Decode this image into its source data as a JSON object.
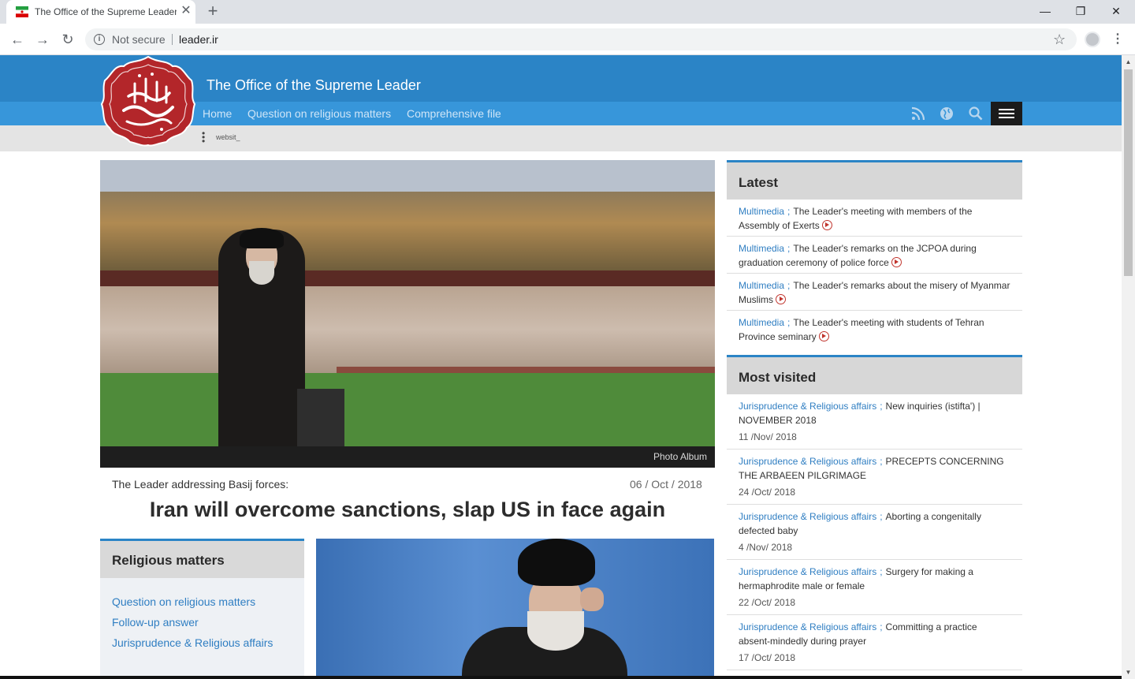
{
  "browser": {
    "tab_title": "The Office of the Supreme Leader",
    "tab_close": "✕",
    "new_tab": "+",
    "window_controls": {
      "minimize": "—",
      "maximize": "❐",
      "close": "✕"
    },
    "security_label": "Not secure",
    "url": "leader.ir"
  },
  "site": {
    "title": "The Office of the Supreme Leader",
    "nav": [
      "Home",
      "Question on religious matters",
      "Comprehensive file"
    ],
    "sub_text": "websit_",
    "colors": {
      "header": "#2b84c6",
      "nav": "#3796da",
      "accent": "#c0342d"
    }
  },
  "featured": {
    "caption": "Photo Album",
    "kicker": "The Leader addressing Basij forces:",
    "date": "06 / Oct / 2018",
    "headline": "Iran will overcome sanctions, slap US in face again"
  },
  "religious": {
    "title": "Religious matters",
    "links": [
      "Question on religious matters",
      "Follow-up answer",
      "Jurisprudence & Religious affairs"
    ]
  },
  "latest": {
    "title": "Latest",
    "items": [
      {
        "category": "Multimedia",
        "text": "The Leader's meeting with members of the Assembly of Exerts"
      },
      {
        "category": "Multimedia",
        "text": "The Leader's remarks on the JCPOA during graduation ceremony of police force"
      },
      {
        "category": "Multimedia",
        "text": "The Leader's remarks about the misery of Myanmar Muslims"
      },
      {
        "category": "Multimedia",
        "text": "The Leader's meeting with students of Tehran Province seminary"
      }
    ]
  },
  "most_visited": {
    "title": "Most visited",
    "items": [
      {
        "category": "Jurisprudence & Religious affairs",
        "text": "New inquiries (istifta') | NOVEMBER 2018",
        "date": "11 /Nov/ 2018"
      },
      {
        "category": "Jurisprudence & Religious affairs",
        "text": "PRECEPTS CONCERNING THE ARBAEEN PILGRIMAGE",
        "date": "24 /Oct/ 2018"
      },
      {
        "category": "Jurisprudence & Religious affairs",
        "text": "Aborting a congenitally defected baby",
        "date": "4 /Nov/ 2018"
      },
      {
        "category": "Jurisprudence & Religious affairs",
        "text": "Surgery for making a hermaphrodite male or female",
        "date": "22 /Oct/ 2018"
      },
      {
        "category": "Jurisprudence & Religious affairs",
        "text": "Committing a practice absent-mindedly during prayer",
        "date": "17 /Oct/ 2018"
      }
    ]
  }
}
